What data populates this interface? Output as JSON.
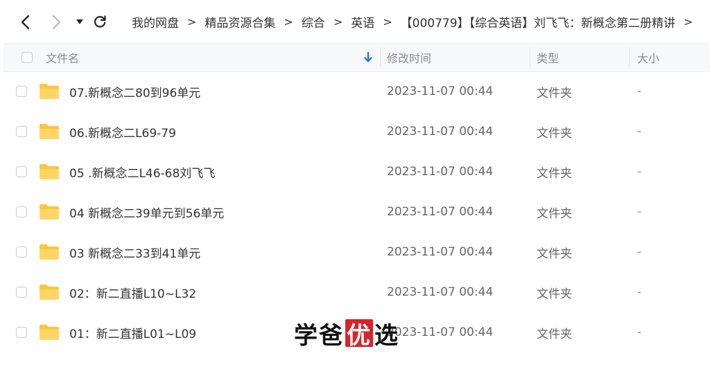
{
  "breadcrumb": [
    "我的网盘",
    "精品资源合集",
    "综合",
    "英语",
    "【000779】【综合英语】刘飞飞：新概念第二册精讲"
  ],
  "breadcrumb_separator": ">",
  "columns": {
    "name": "文件名",
    "modified": "修改时间",
    "type": "类型",
    "size": "大小"
  },
  "files": [
    {
      "name": "07.新概念二80到96单元",
      "modified": "2023-11-07 00:44",
      "type": "文件夹",
      "size": "-"
    },
    {
      "name": "06.新概念二L69-79",
      "modified": "2023-11-07 00:44",
      "type": "文件夹",
      "size": "-"
    },
    {
      "name": "05 .新概念二L46-68刘飞飞",
      "modified": "2023-11-07 00:44",
      "type": "文件夹",
      "size": "-"
    },
    {
      "name": "04 新概念二39单元到56单元",
      "modified": "2023-11-07 00:44",
      "type": "文件夹",
      "size": "-"
    },
    {
      "name": "03 新概念二33到41单元",
      "modified": "2023-11-07 00:44",
      "type": "文件夹",
      "size": "-"
    },
    {
      "name": "02：新二直播L10~L32",
      "modified": "2023-11-07 00:44",
      "type": "文件夹",
      "size": "-"
    },
    {
      "name": "01：新二直播L01~L09",
      "modified": "2023-11-07 00:44",
      "type": "文件夹",
      "size": "-"
    }
  ],
  "watermark": {
    "part1": "学爸",
    "seal": "优",
    "part2": "选"
  },
  "icons": {
    "back": "chevron-left-icon",
    "forward": "chevron-right-icon",
    "dropdown": "caret-down-icon",
    "refresh": "refresh-icon",
    "sort": "sort-down-arrow-icon",
    "folder": "folder-icon"
  },
  "colors": {
    "accent": "#1a73e8",
    "folder": "#ffc53d",
    "seal": "#d9232a"
  }
}
